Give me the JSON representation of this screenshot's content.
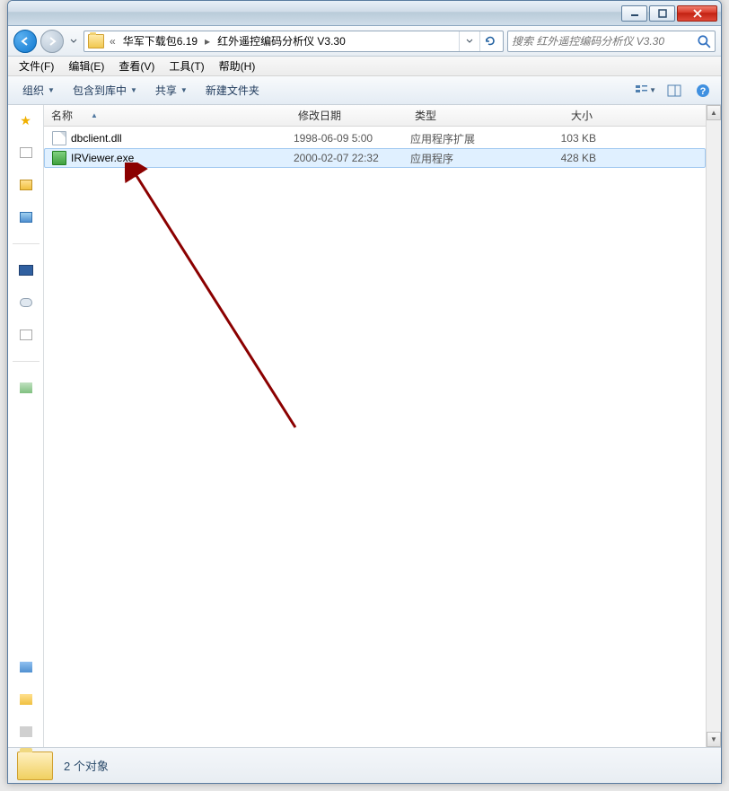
{
  "breadcrumb": {
    "prefix": "«",
    "seg1": "华军下载包6.19",
    "seg2": "红外遥控编码分析仪 V3.30"
  },
  "search": {
    "placeholder": "搜索 红外遥控编码分析仪 V3.30"
  },
  "menu": {
    "file": "文件(F)",
    "edit": "编辑(E)",
    "view": "查看(V)",
    "tools": "工具(T)",
    "help": "帮助(H)"
  },
  "toolbar": {
    "organize": "组织",
    "include": "包含到库中",
    "share": "共享",
    "newfolder": "新建文件夹"
  },
  "columns": {
    "name": "名称",
    "date": "修改日期",
    "type": "类型",
    "size": "大小"
  },
  "files": [
    {
      "name": "dbclient.dll",
      "date": "1998-06-09 5:00",
      "type": "应用程序扩展",
      "size": "103 KB",
      "kind": "dll",
      "selected": false
    },
    {
      "name": "IRViewer.exe",
      "date": "2000-02-07 22:32",
      "type": "应用程序",
      "size": "428 KB",
      "kind": "exe",
      "selected": true
    }
  ],
  "status": {
    "text": "2 个对象"
  }
}
